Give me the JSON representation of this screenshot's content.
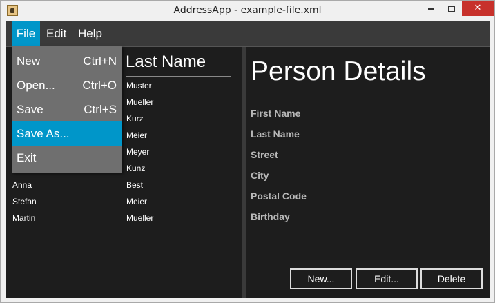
{
  "window": {
    "title": "AddressApp - example-file.xml",
    "close_glyph": "✕"
  },
  "menubar": {
    "file": "File",
    "edit": "Edit",
    "help": "Help"
  },
  "file_menu": {
    "items": [
      {
        "label": "New",
        "accel": "Ctrl+N"
      },
      {
        "label": "Open...",
        "accel": "Ctrl+O"
      },
      {
        "label": "Save",
        "accel": "Ctrl+S"
      },
      {
        "label": "Save As...",
        "accel": ""
      },
      {
        "label": "Exit",
        "accel": ""
      }
    ]
  },
  "table": {
    "last_name_header": "Last Name",
    "rows": [
      {
        "first": "",
        "last": "Muster"
      },
      {
        "first": "",
        "last": "Mueller"
      },
      {
        "first": "",
        "last": "Kurz"
      },
      {
        "first": "",
        "last": "Meier"
      },
      {
        "first": "",
        "last": "Meyer"
      },
      {
        "first": "",
        "last": "Kunz"
      },
      {
        "first": "Anna",
        "last": "Best"
      },
      {
        "first": "Stefan",
        "last": "Meier"
      },
      {
        "first": "Martin",
        "last": "Mueller"
      }
    ]
  },
  "details": {
    "title": "Person Details",
    "labels": [
      "First Name",
      "Last Name",
      "Street",
      "City",
      "Postal Code",
      "Birthday"
    ]
  },
  "buttons": {
    "new": "New...",
    "edit": "Edit...",
    "delete": "Delete"
  }
}
